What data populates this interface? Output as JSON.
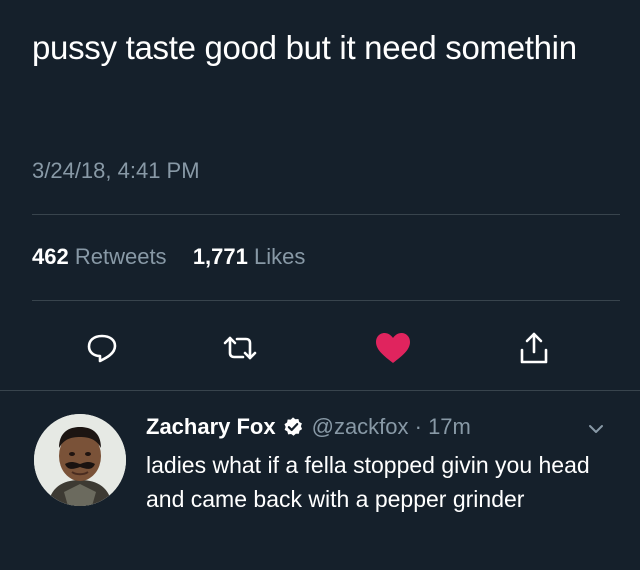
{
  "tweet": {
    "text": "pussy taste good but it need somethin",
    "timestamp": "3/24/18, 4:41 PM",
    "retweet_count": "462",
    "retweet_label": "Retweets",
    "like_count": "1,771",
    "like_label": "Likes",
    "liked": true
  },
  "actions": [
    {
      "name": "reply",
      "icon": "speech-bubble-icon"
    },
    {
      "name": "retweet",
      "icon": "retweet-icon"
    },
    {
      "name": "like",
      "icon": "heart-icon"
    },
    {
      "name": "share",
      "icon": "share-icon"
    }
  ],
  "reply": {
    "name": "Zachary Fox",
    "verified": true,
    "handle_time": "@zackfox · 17m",
    "text": "ladies what if a fella stopped givin you head and came back with a pepper grinder"
  },
  "colors": {
    "background": "#15202b",
    "text": "#ffffff",
    "muted": "#8899a6",
    "divider": "#38444d",
    "like": "#e0245e"
  }
}
